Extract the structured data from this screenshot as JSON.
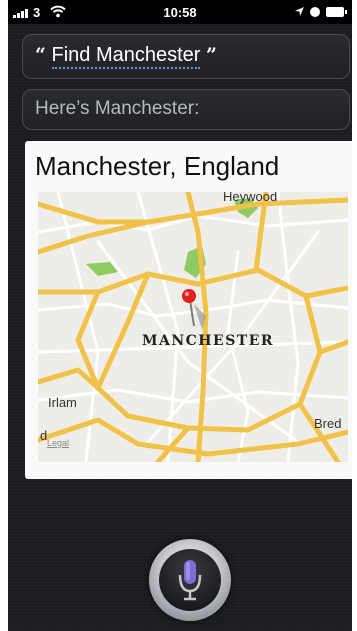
{
  "status_bar": {
    "carrier": "3",
    "time": "10:58"
  },
  "conversation": {
    "query_open_quote": "“",
    "query_text": "Find Manchester",
    "query_close_quote": "”",
    "reply": "Here’s Manchester:"
  },
  "map_card": {
    "title": "Manchester, England",
    "city_label": "MANCHESTER",
    "places": {
      "heywood": "Heywood",
      "irlam": "Irlam",
      "bred": "Bred",
      "edge_letter": "d"
    },
    "legal": "Legal"
  },
  "icons": {
    "signal": "signal-bars-icon",
    "wifi": "wifi-icon",
    "location": "location-arrow-icon",
    "alarm": "alarm-icon",
    "battery": "battery-icon",
    "pin": "map-pin-icon",
    "mic": "microphone-icon"
  },
  "colors": {
    "motorway": "#f0c24a",
    "minor_road": "#ffffff",
    "park": "#8dcb63",
    "pin": "#e02020",
    "dictation_underline": "#6b8ed6"
  }
}
